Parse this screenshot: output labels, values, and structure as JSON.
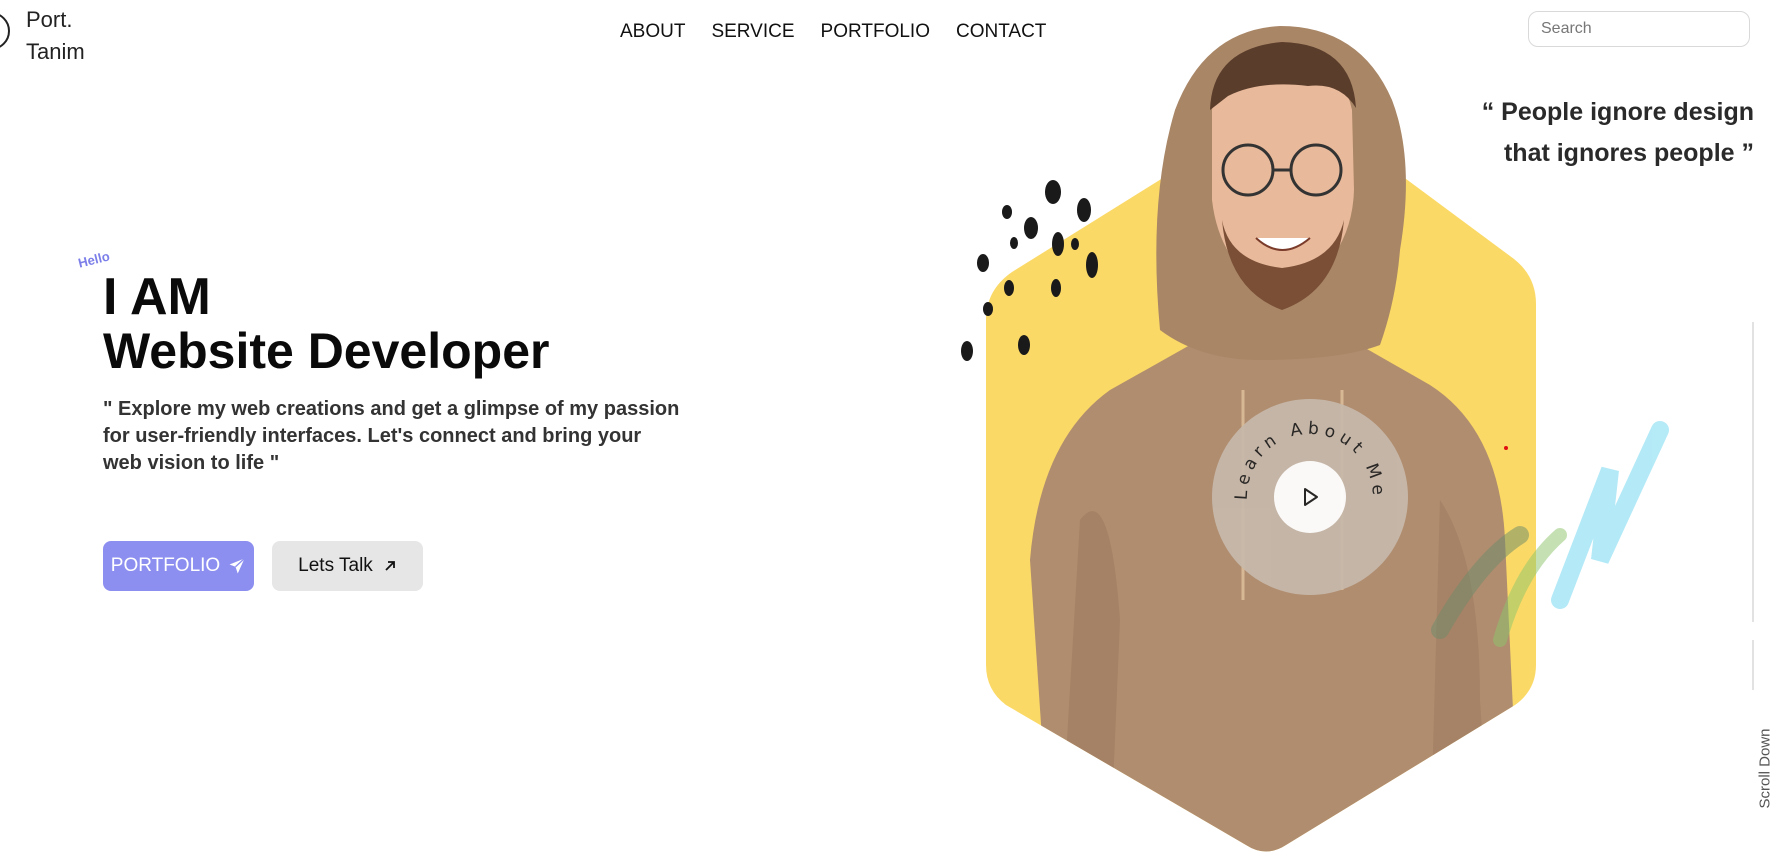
{
  "header": {
    "logo_text": "Port.\nTanim",
    "nav": [
      "ABOUT",
      "SERVICE",
      "PORTFOLIO",
      "CONTACT"
    ],
    "search_placeholder": "Search"
  },
  "hero": {
    "hello": "Hello",
    "headline_line1": "I AM",
    "headline_line2": "Website Developer",
    "description": "\" Explore my web creations and get a glimpse of my passion for user-friendly interfaces. Let's connect and bring your web vision to life \"",
    "portfolio_button": "PORTFOLIO",
    "talk_button": "Lets Talk",
    "quote_line1": "“ People ignore design",
    "quote_line2": "that ignores people ”",
    "learn_about_me": "Learn About Me",
    "scroll_down": "Scroll Down"
  },
  "colors": {
    "accent": "#8d8ff0",
    "hexagon": "#fbd966",
    "hoodie": "#b08d6f"
  }
}
